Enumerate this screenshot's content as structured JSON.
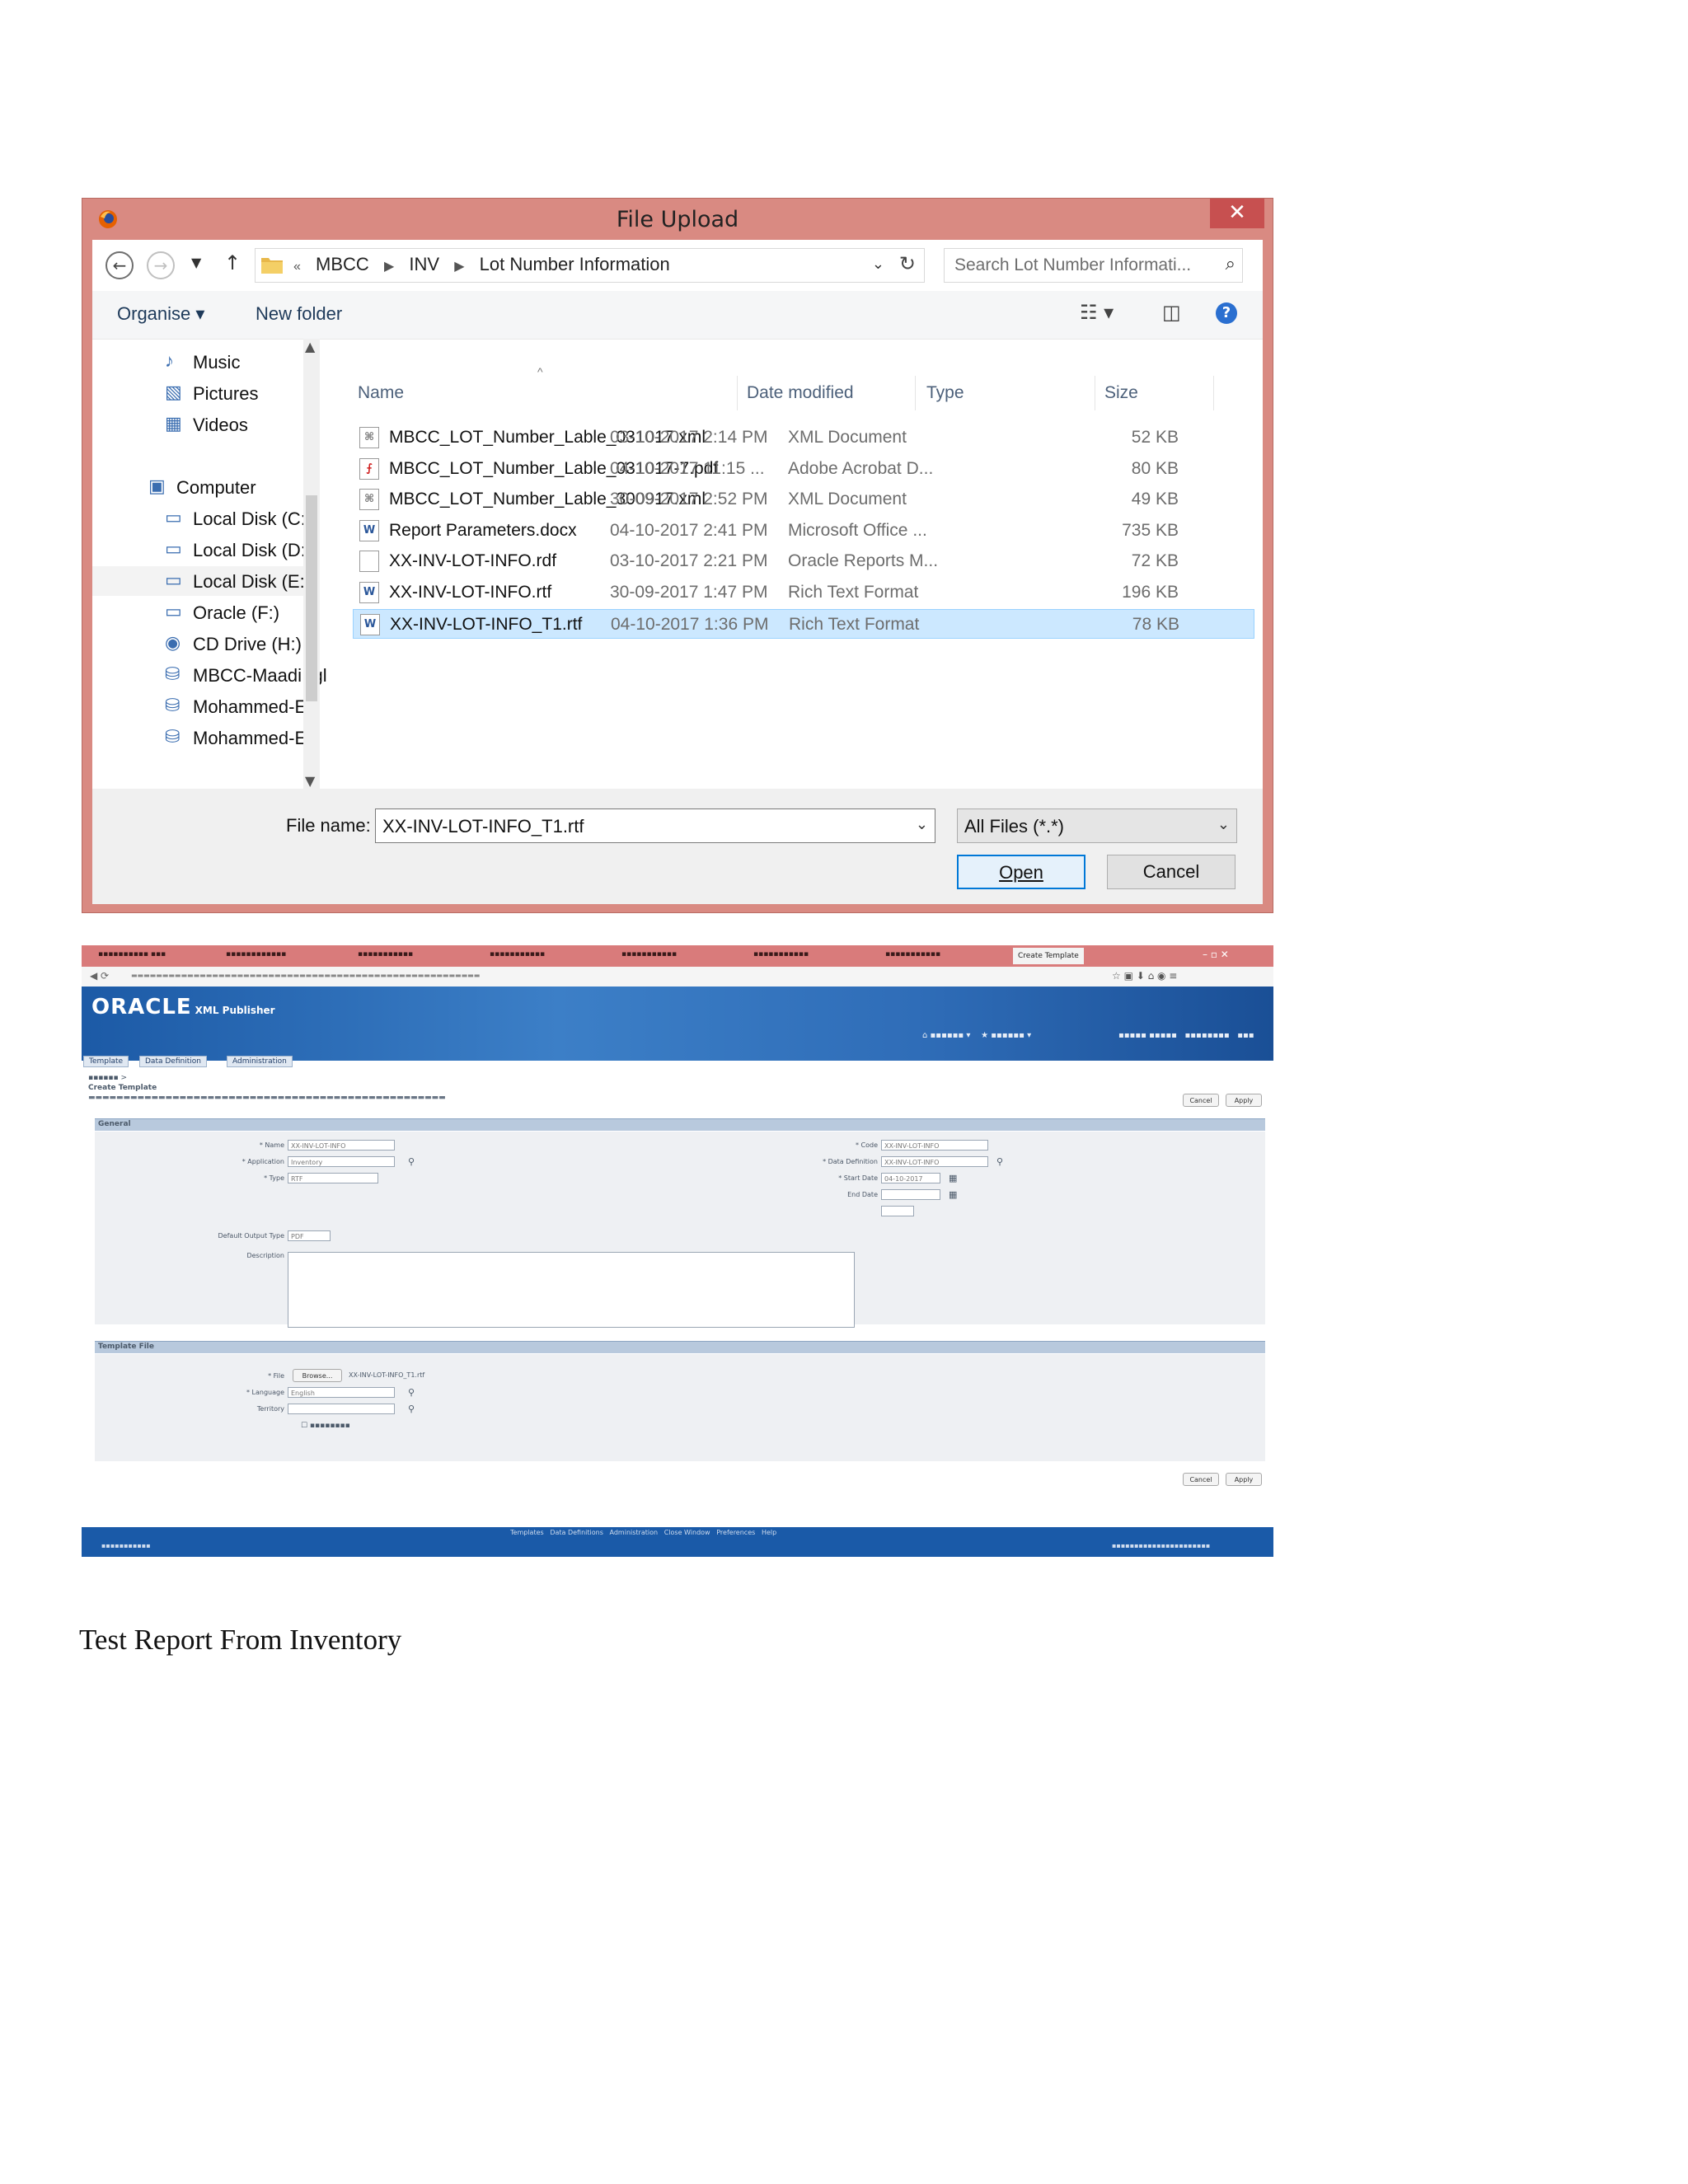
{
  "dialog": {
    "title": "File Upload",
    "close_label": "✕",
    "breadcrumb": {
      "overflow": "«",
      "parts": [
        "MBCC",
        "INV",
        "Lot Number Information"
      ]
    },
    "search_placeholder": "Search Lot Number Informati...",
    "toolbar": {
      "organise": "Organise ▾",
      "new_folder": "New folder"
    },
    "nav": [
      "Music",
      "Pictures",
      "Videos",
      "Computer",
      "Local Disk (C:)",
      "Local Disk (D:)",
      "Local Disk (E:)",
      "Oracle (F:)",
      "CD Drive (H:)",
      "MBCC-Maadi (gl",
      "Mohammed-Elg",
      "Mohammed-Elg"
    ],
    "columns": {
      "name": "Name",
      "date": "Date modified",
      "type": "Type",
      "size": "Size"
    },
    "files": [
      {
        "name": "MBCC_LOT_Number_Lable_031017.xml",
        "date": "03-10-2017 2:14 PM",
        "type": "XML Document",
        "size": "52 KB",
        "icon": "xml-file-icon"
      },
      {
        "name": "MBCC_LOT_Number_Lable_031017-7.pdf",
        "date": "04-10-2017 11:15 ...",
        "type": "Adobe Acrobat D...",
        "size": "80 KB",
        "icon": "pdf-file-icon"
      },
      {
        "name": "MBCC_LOT_Number_Lable_300917.xml",
        "date": "30-09-2017 2:52 PM",
        "type": "XML Document",
        "size": "49 KB",
        "icon": "xml-file-icon"
      },
      {
        "name": "Report Parameters.docx",
        "date": "04-10-2017 2:41 PM",
        "type": "Microsoft Office ...",
        "size": "735 KB",
        "icon": "word-file-icon"
      },
      {
        "name": "XX-INV-LOT-INFO.rdf",
        "date": "03-10-2017 2:21 PM",
        "type": "Oracle Reports M...",
        "size": "72 KB",
        "icon": "blank-file-icon"
      },
      {
        "name": "XX-INV-LOT-INFO.rtf",
        "date": "30-09-2017 1:47 PM",
        "type": "Rich Text Format",
        "size": "196 KB",
        "icon": "word-file-icon"
      },
      {
        "name": "XX-INV-LOT-INFO_T1.rtf",
        "date": "04-10-2017 1:36 PM",
        "type": "Rich Text Format",
        "size": "78 KB",
        "icon": "word-file-icon",
        "selected": true
      }
    ],
    "file_name_label": "File name:",
    "file_name_value": "XX-INV-LOT-INFO_T1.rtf",
    "filter_value": "All Files (*.*)",
    "open_label": "Open",
    "cancel_label": "Cancel"
  },
  "oracle": {
    "logo": "ORACLE",
    "product": "XML Publisher",
    "tabs": [
      "Template",
      "Data Definition",
      "Administration"
    ],
    "page_title": "Create Template",
    "general_section": "General",
    "template_file_section": "Template File",
    "labels": {
      "name": "* Name",
      "application": "* Application",
      "type": "* Type",
      "code": "* Code",
      "data_definition": "* Data Definition",
      "start_date": "* Start Date",
      "end_date": "End Date",
      "default_output": "Default Output Type",
      "description": "Description",
      "file": "* File",
      "language": "* Language",
      "territory": "Territory"
    },
    "values": {
      "name": "XX-INV-LOT-INFO",
      "application": "Inventory",
      "type": "RTF",
      "code": "XX-INV-LOT-INFO",
      "data_definition": "XX-INV-LOT-INFO",
      "start_date": "04-10-2017",
      "default_output": "PDF",
      "file_name": "XX-INV-LOT-INFO_T1.rtf",
      "language": "English",
      "browse": "Browse..."
    },
    "buttons": {
      "cancel": "Cancel",
      "apply": "Apply"
    },
    "footer_links": [
      "Templates",
      "Data Definitions",
      "Administration",
      "Close Window",
      "Preferences",
      "Help"
    ]
  },
  "caption": "Test Report From Inventory"
}
